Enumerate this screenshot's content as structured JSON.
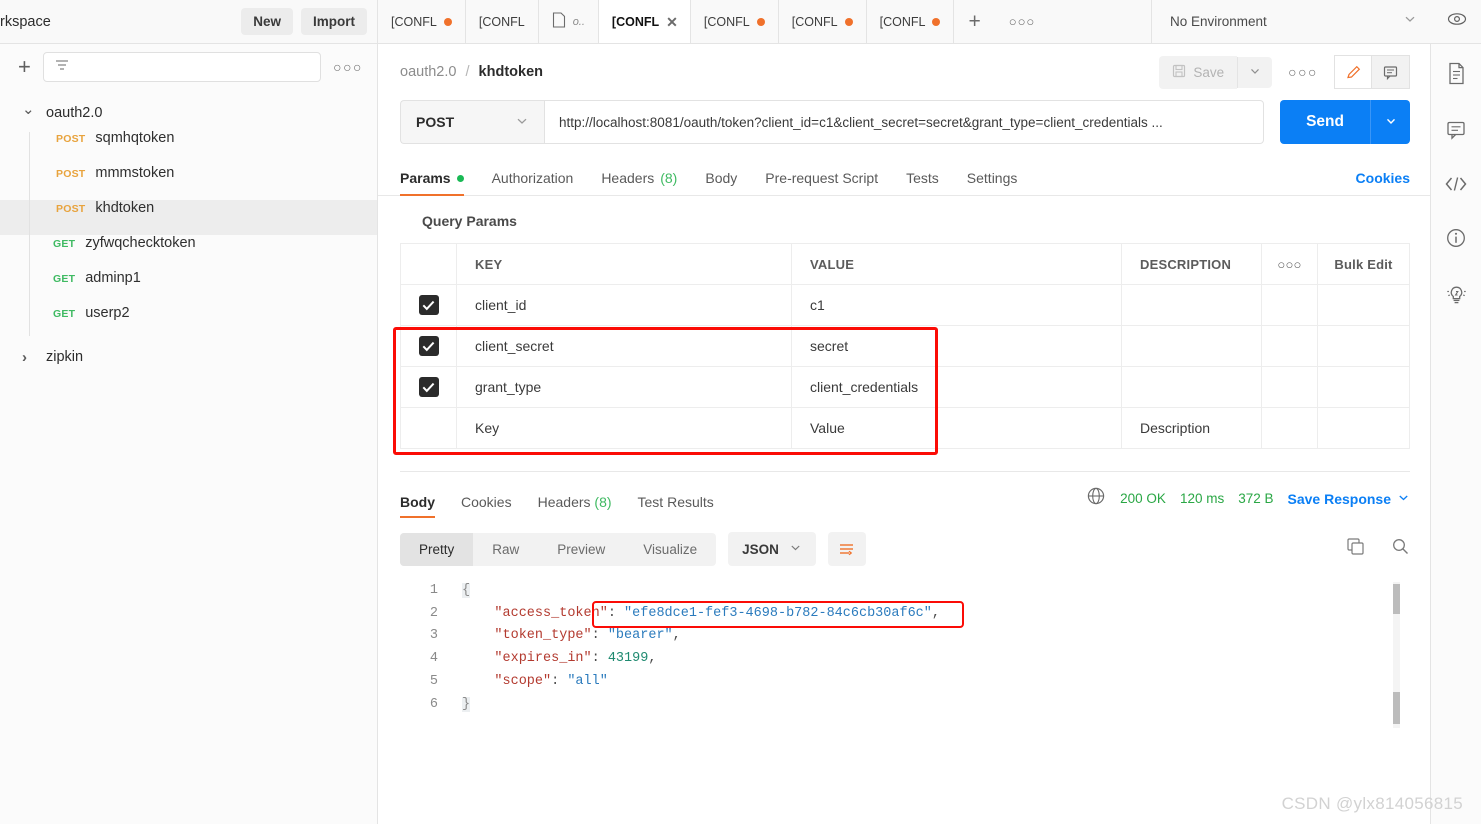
{
  "topbar": {
    "workspace_title": "rkspace",
    "new_label": "New",
    "import_label": "Import",
    "plus_icon": "plus-icon",
    "more_icon": "ellipsis-icon",
    "environment": {
      "selected": "No Environment",
      "chevron": "chevron-down-icon",
      "eye_icon": "eye-icon"
    },
    "request_tabs": [
      {
        "label": "[CONFL",
        "dirty": true,
        "active": false,
        "closable": false,
        "subtitle": ""
      },
      {
        "label": "[CONFL",
        "dirty": false,
        "active": false,
        "closable": false,
        "subtitle": ""
      },
      {
        "label": "",
        "dirty": false,
        "active": false,
        "closable": false,
        "subtitle": "o..",
        "icon": "document-icon"
      },
      {
        "label": "[CONFL",
        "dirty": false,
        "active": true,
        "closable": true,
        "subtitle": ""
      },
      {
        "label": "[CONFL",
        "dirty": true,
        "active": false,
        "closable": false,
        "subtitle": ""
      },
      {
        "label": "[CONFL",
        "dirty": true,
        "active": false,
        "closable": false,
        "subtitle": ""
      },
      {
        "label": "[CONFL",
        "dirty": true,
        "active": false,
        "closable": false,
        "subtitle": ""
      }
    ]
  },
  "sidebar": {
    "plus_icon": "plus-icon",
    "filter_icon": "filter-icon",
    "more_icon": "ellipsis-icon",
    "filter_placeholder": "",
    "collections": [
      {
        "name": "oauth2.0",
        "expanded": true,
        "caret": "chevron-down-icon",
        "items": [
          {
            "method": "POST",
            "name": "sqmhqtoken",
            "selected": false
          },
          {
            "method": "POST",
            "name": "mmmstoken",
            "selected": false
          },
          {
            "method": "POST",
            "name": "khdtoken",
            "selected": true
          },
          {
            "method": "GET",
            "name": "zyfwqchecktoken",
            "selected": false
          },
          {
            "method": "GET",
            "name": "adminp1",
            "selected": false
          },
          {
            "method": "GET",
            "name": "userp2",
            "selected": false
          }
        ]
      },
      {
        "name": "zipkin",
        "expanded": false,
        "caret": "chevron-right-icon",
        "items": []
      }
    ]
  },
  "request": {
    "breadcrumb": {
      "collection": "oauth2.0",
      "separator": "/",
      "name": "khdtoken"
    },
    "save_label": "Save",
    "save_icon": "save-disk-icon",
    "save_caret_icon": "chevron-down-icon",
    "more_icon": "ellipsis-icon",
    "edit_icon": "pencil-icon",
    "comment_icon": "comment-icon",
    "method": "POST",
    "method_caret": "chevron-down-icon",
    "url": "http://localhost:8081/oauth/token?client_id=c1&client_secret=secret&grant_type=client_credentials ...",
    "send_label": "Send",
    "send_caret_icon": "chevron-down-icon",
    "tabs": [
      {
        "label": "Params",
        "active": true,
        "dot": true,
        "count": ""
      },
      {
        "label": "Authorization",
        "active": false,
        "dot": false,
        "count": ""
      },
      {
        "label": "Headers",
        "active": false,
        "dot": false,
        "count": "(8)"
      },
      {
        "label": "Body",
        "active": false,
        "dot": false,
        "count": ""
      },
      {
        "label": "Pre-request Script",
        "active": false,
        "dot": false,
        "count": ""
      },
      {
        "label": "Tests",
        "active": false,
        "dot": false,
        "count": ""
      },
      {
        "label": "Settings",
        "active": false,
        "dot": false,
        "count": ""
      }
    ],
    "cookies_label": "Cookies"
  },
  "params": {
    "section_title": "Query Params",
    "columns": {
      "key": "KEY",
      "value": "VALUE",
      "description": "DESCRIPTION"
    },
    "more_icon": "ellipsis-icon",
    "bulk_edit_label": "Bulk Edit",
    "rows": [
      {
        "checked": true,
        "key": "client_id",
        "value": "c1",
        "description": ""
      },
      {
        "checked": true,
        "key": "client_secret",
        "value": "secret",
        "description": ""
      },
      {
        "checked": true,
        "key": "grant_type",
        "value": "client_credentials",
        "description": ""
      }
    ],
    "empty_row": {
      "key_placeholder": "Key",
      "value_placeholder": "Value",
      "description_placeholder": "Description"
    },
    "highlight_color": "#fb0c06"
  },
  "response": {
    "tabs": [
      {
        "label": "Body",
        "active": true,
        "count": ""
      },
      {
        "label": "Cookies",
        "active": false,
        "count": ""
      },
      {
        "label": "Headers",
        "active": false,
        "count": "(8)"
      },
      {
        "label": "Test Results",
        "active": false,
        "count": ""
      }
    ],
    "globe_icon": "globe-icon",
    "status": "200 OK",
    "time": "120 ms",
    "size": "372 B",
    "save_response_label": "Save Response",
    "save_response_caret": "chevron-down-icon",
    "format_tabs": [
      {
        "label": "Pretty",
        "active": true
      },
      {
        "label": "Raw",
        "active": false
      },
      {
        "label": "Preview",
        "active": false
      },
      {
        "label": "Visualize",
        "active": false
      }
    ],
    "language": "JSON",
    "language_caret": "chevron-down-icon",
    "wrap_icon": "word-wrap-icon",
    "copy_icon": "copy-icon",
    "search_icon": "search-icon",
    "body_lines": [
      {
        "n": "1",
        "segments": [
          {
            "t": "{",
            "c": "brace"
          }
        ]
      },
      {
        "n": "2",
        "segments": [
          {
            "t": "    \"access_token\"",
            "c": "k"
          },
          {
            "t": ":",
            "c": "p"
          },
          {
            "t": " \"efe8dce1-fef3-4698-b782-84c6cb30af6c\"",
            "c": "s"
          },
          {
            "t": ",",
            "c": "p"
          }
        ]
      },
      {
        "n": "3",
        "segments": [
          {
            "t": "    \"token_type\"",
            "c": "k"
          },
          {
            "t": ":",
            "c": "p"
          },
          {
            "t": " \"bearer\"",
            "c": "s"
          },
          {
            "t": ",",
            "c": "p"
          }
        ]
      },
      {
        "n": "4",
        "segments": [
          {
            "t": "    \"expires_in\"",
            "c": "k"
          },
          {
            "t": ":",
            "c": "p"
          },
          {
            "t": " 43199",
            "c": "n"
          },
          {
            "t": ",",
            "c": "p"
          }
        ]
      },
      {
        "n": "5",
        "segments": [
          {
            "t": "    \"scope\"",
            "c": "k"
          },
          {
            "t": ":",
            "c": "p"
          },
          {
            "t": " \"all\"",
            "c": "s"
          }
        ]
      },
      {
        "n": "6",
        "segments": [
          {
            "t": "}",
            "c": "brace"
          }
        ]
      }
    ],
    "highlighted_token": "efe8dce1-fef3-4698-b782-84c6cb30af6c"
  },
  "rail_icons": [
    "document-icon",
    "comment-icon",
    "code-icon",
    "info-icon",
    "lightbulb-icon"
  ],
  "watermark": "CSDN @ylx814056815"
}
